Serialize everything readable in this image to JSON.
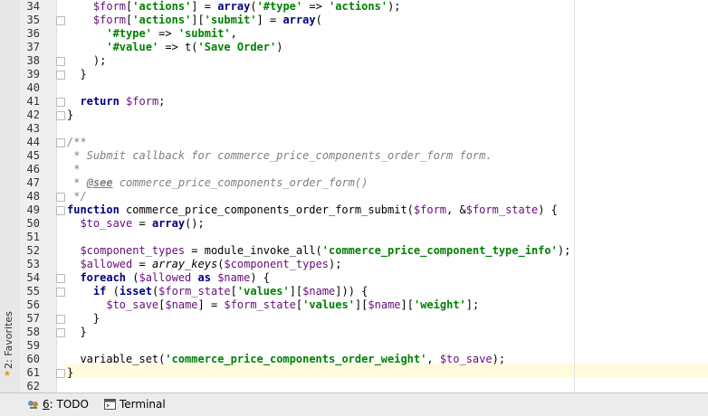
{
  "sidebar": {
    "favorites_label": "2: Favorites"
  },
  "status_bar": {
    "todo_number": "6",
    "todo_label": ": TODO",
    "terminal_label": "Terminal"
  },
  "editor": {
    "lines": [
      {
        "n": "34",
        "tokens": [
          [
            "",
            "    "
          ],
          [
            "var",
            "$form"
          ],
          [
            "",
            "["
          ],
          [
            "str",
            "'actions'"
          ],
          [
            "",
            "] = "
          ],
          [
            "kw",
            "array"
          ],
          [
            "",
            "("
          ],
          [
            "str",
            "'#type'"
          ],
          [
            "",
            " => "
          ],
          [
            "str",
            "'actions'"
          ],
          [
            "",
            ");"
          ]
        ]
      },
      {
        "n": "35",
        "tokens": [
          [
            "",
            "    "
          ],
          [
            "var",
            "$form"
          ],
          [
            "",
            "["
          ],
          [
            "str",
            "'actions'"
          ],
          [
            "",
            "]["
          ],
          [
            "str",
            "'submit'"
          ],
          [
            "",
            "] = "
          ],
          [
            "kw",
            "array"
          ],
          [
            "",
            "("
          ]
        ]
      },
      {
        "n": "36",
        "tokens": [
          [
            "",
            "      "
          ],
          [
            "str",
            "'#type'"
          ],
          [
            "",
            " => "
          ],
          [
            "str",
            "'submit'"
          ],
          [
            "",
            ","
          ]
        ]
      },
      {
        "n": "37",
        "tokens": [
          [
            "",
            "      "
          ],
          [
            "str",
            "'#value'"
          ],
          [
            "",
            " => t("
          ],
          [
            "str",
            "'Save Order'"
          ],
          [
            "",
            ")"
          ]
        ]
      },
      {
        "n": "38",
        "tokens": [
          [
            "",
            "    );"
          ]
        ]
      },
      {
        "n": "39",
        "tokens": [
          [
            "",
            "  }"
          ]
        ]
      },
      {
        "n": "40",
        "tokens": []
      },
      {
        "n": "41",
        "tokens": [
          [
            "",
            "  "
          ],
          [
            "kw",
            "return"
          ],
          [
            "",
            " "
          ],
          [
            "var",
            "$form"
          ],
          [
            "",
            ";"
          ]
        ]
      },
      {
        "n": "42",
        "tokens": [
          [
            "",
            "}"
          ]
        ]
      },
      {
        "n": "43",
        "tokens": []
      },
      {
        "n": "44",
        "tokens": [
          [
            "cmt",
            "/**"
          ]
        ]
      },
      {
        "n": "45",
        "tokens": [
          [
            "cmt",
            " * Submit callback for commerce_price_components_order_form form."
          ]
        ]
      },
      {
        "n": "46",
        "tokens": [
          [
            "cmt",
            " *"
          ]
        ]
      },
      {
        "n": "47",
        "tokens": [
          [
            "cmt",
            " * "
          ],
          [
            "tag",
            "@see"
          ],
          [
            "cmt",
            " commerce_price_components_order_form()"
          ]
        ]
      },
      {
        "n": "48",
        "tokens": [
          [
            "cmt",
            " */"
          ]
        ]
      },
      {
        "n": "49",
        "tokens": [
          [
            "kw",
            "function"
          ],
          [
            "",
            " commerce_price_components_order_form_submit("
          ],
          [
            "var",
            "$form"
          ],
          [
            "",
            ", &"
          ],
          [
            "var",
            "$form_state"
          ],
          [
            "",
            ") {"
          ]
        ]
      },
      {
        "n": "50",
        "tokens": [
          [
            "",
            "  "
          ],
          [
            "var",
            "$to_save"
          ],
          [
            "",
            " = "
          ],
          [
            "kw",
            "array"
          ],
          [
            "",
            "();"
          ]
        ]
      },
      {
        "n": "51",
        "tokens": []
      },
      {
        "n": "52",
        "tokens": [
          [
            "",
            "  "
          ],
          [
            "var",
            "$component_types"
          ],
          [
            "",
            " = module_invoke_all("
          ],
          [
            "str",
            "'commerce_price_component_type_info'"
          ],
          [
            "",
            ");"
          ]
        ]
      },
      {
        "n": "53",
        "tokens": [
          [
            "",
            "  "
          ],
          [
            "var",
            "$allowed"
          ],
          [
            "",
            " = "
          ],
          [
            "fn-italic",
            "array_keys"
          ],
          [
            "",
            "("
          ],
          [
            "var",
            "$component_types"
          ],
          [
            "",
            ");"
          ]
        ]
      },
      {
        "n": "54",
        "tokens": [
          [
            "",
            "  "
          ],
          [
            "kw",
            "foreach"
          ],
          [
            "",
            " ("
          ],
          [
            "var",
            "$allowed"
          ],
          [
            "",
            " "
          ],
          [
            "kw",
            "as"
          ],
          [
            "",
            " "
          ],
          [
            "var",
            "$name"
          ],
          [
            "",
            ") {"
          ]
        ]
      },
      {
        "n": "55",
        "tokens": [
          [
            "",
            "    "
          ],
          [
            "kw",
            "if"
          ],
          [
            "",
            " ("
          ],
          [
            "kw",
            "isset"
          ],
          [
            "",
            "("
          ],
          [
            "var",
            "$form_state"
          ],
          [
            "",
            "["
          ],
          [
            "str",
            "'values'"
          ],
          [
            "",
            "]["
          ],
          [
            "var",
            "$name"
          ],
          [
            "",
            "])) {"
          ]
        ]
      },
      {
        "n": "56",
        "tokens": [
          [
            "",
            "      "
          ],
          [
            "var",
            "$to_save"
          ],
          [
            "",
            "["
          ],
          [
            "var",
            "$name"
          ],
          [
            "",
            "] = "
          ],
          [
            "var",
            "$form_state"
          ],
          [
            "",
            "["
          ],
          [
            "str",
            "'values'"
          ],
          [
            "",
            "]["
          ],
          [
            "var",
            "$name"
          ],
          [
            "",
            "]["
          ],
          [
            "str",
            "'weight'"
          ],
          [
            "",
            "];"
          ]
        ]
      },
      {
        "n": "57",
        "tokens": [
          [
            "",
            "    }"
          ]
        ]
      },
      {
        "n": "58",
        "tokens": [
          [
            "",
            "  }"
          ]
        ]
      },
      {
        "n": "59",
        "tokens": []
      },
      {
        "n": "60",
        "tokens": [
          [
            "",
            "  variable_set("
          ],
          [
            "str",
            "'commerce_price_components_order_weight'"
          ],
          [
            "",
            ", "
          ],
          [
            "var",
            "$to_save"
          ],
          [
            "",
            ");"
          ]
        ]
      },
      {
        "n": "61",
        "tokens": [
          [
            "",
            "}"
          ]
        ]
      },
      {
        "n": "62",
        "tokens": []
      }
    ]
  }
}
